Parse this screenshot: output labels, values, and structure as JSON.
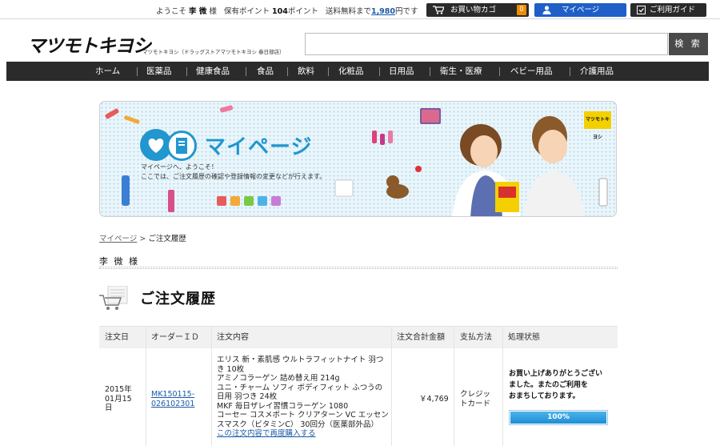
{
  "topbar": {
    "welcome_prefix": "ようこそ",
    "user_name": "李 微",
    "welcome_suffix": "様",
    "points_label": "保有ポイント",
    "points_value": "104",
    "points_unit": "ポイント",
    "free_shipping_prefix": "送料無料まで",
    "free_shipping_amount": "1,980",
    "free_shipping_suffix": "円です",
    "cart_label": "お買い物カゴ",
    "cart_count": "0",
    "mypage_label": "マイページ",
    "guide_label": "ご利用ガイド"
  },
  "header": {
    "logo_text": "マツモトキヨシ",
    "logo_sub": "マツモトキヨシ（ドラッグストアマツモトキヨシ 春日部店）",
    "search_placeholder": "",
    "search_button": "検 索"
  },
  "nav": {
    "items": [
      "ホーム",
      "医薬品",
      "健康食品",
      "食品",
      "飲料",
      "化粧品",
      "日用品",
      "衛生・医療",
      "ベビー用品",
      "介護用品"
    ]
  },
  "banner": {
    "title": "マイページ",
    "line1": "マイページへ、ようこそ！",
    "line2": "ここでは、ご注文履歴の確認や登録情報の変更などが行えます。",
    "brand_tag": "マツモトキヨシ"
  },
  "breadcrumb": {
    "home": "マイページ",
    "separator": ">",
    "current": "ご注文履歴"
  },
  "customer_name": "李 微 様",
  "page_title": "ご注文履歴",
  "table": {
    "headers": [
      "注文日",
      "オーダーＩＤ",
      "注文内容",
      "注文合計金額",
      "支払方法",
      "処理状態"
    ],
    "rows": [
      {
        "date_line1": "2015年",
        "date_line2": "01月15",
        "date_line3": "日",
        "order_id_line1": "MK150115-",
        "order_id_line2": "026102301",
        "items": [
          "エリス 新・素肌感 ウルトラフィットナイト 羽つき 10枚",
          "アミノコラーゲン 詰め替え用 214g",
          "ユニ・チャーム ソフィ ボディフィット ふつうの日用 羽つき 24枚",
          "MKF 毎日ザレイ習慣コラーゲン 1080",
          "コーセー コスメポート クリアターン VC エッセンスマスク（ビタミンC） 30回分（医薬部外品）"
        ],
        "reorder_link": "この注文内容で再度購入する",
        "total": "￥4,769",
        "payment_line1": "クレジッ",
        "payment_line2": "トカード",
        "status_line1": "お買い上げありがとうござい",
        "status_line2": "ました。またのご利用を",
        "status_line3": "おまちしております。",
        "progress_percent": 100,
        "progress_label": "100%"
      }
    ]
  },
  "colors": {
    "nav_bg": "#2b2b2b",
    "accent_blue": "#1f5fc7",
    "cart_badge": "#f08c00",
    "banner_title": "#2196cf",
    "progress": "#1d8fd6"
  }
}
